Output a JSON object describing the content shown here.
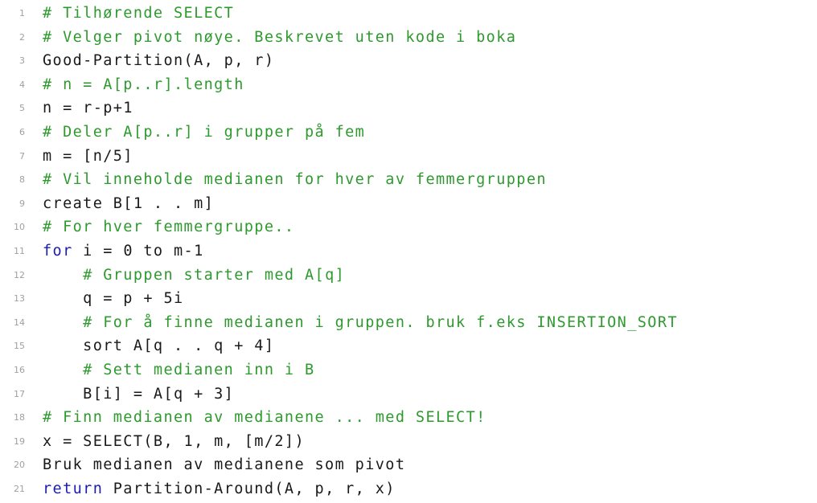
{
  "listing": {
    "lines": [
      {
        "num": "1",
        "text": "# Tilhørende SELECT",
        "kind": "comment"
      },
      {
        "num": "2",
        "text": "# Velger pivot nøye. Beskrevet uten kode i boka",
        "kind": "comment"
      },
      {
        "num": "3",
        "text": "Good-Partition(A, p, r)",
        "kind": "code"
      },
      {
        "num": "4",
        "text": "# n = A[p..r].length",
        "kind": "comment"
      },
      {
        "num": "5",
        "text": "n = r-p+1",
        "kind": "code"
      },
      {
        "num": "6",
        "text": "# Deler A[p..r] i grupper på fem",
        "kind": "comment"
      },
      {
        "num": "7",
        "text": "m = [n/5]",
        "kind": "code"
      },
      {
        "num": "8",
        "text": "# Vil inneholde medianen for hver av femmergruppen",
        "kind": "comment"
      },
      {
        "num": "9",
        "text": "create B[1 . . m]",
        "kind": "code"
      },
      {
        "num": "10",
        "text": "# For hver femmergruppe..",
        "kind": "comment"
      },
      {
        "num": "11",
        "keyword": "for",
        "rest": " i = 0 to m-1",
        "kind": "keyword"
      },
      {
        "num": "12",
        "indent": "    ",
        "text": "# Gruppen starter med A[q]",
        "kind": "comment"
      },
      {
        "num": "13",
        "indent": "    ",
        "text": "q = p + 5i",
        "kind": "code"
      },
      {
        "num": "14",
        "indent": "    ",
        "text": "# For å finne medianen i gruppen. bruk f.eks INSERTION_SORT",
        "kind": "comment"
      },
      {
        "num": "15",
        "indent": "    ",
        "text": "sort A[q . . q + 4]",
        "kind": "code"
      },
      {
        "num": "16",
        "indent": "    ",
        "text": "# Sett medianen inn i B",
        "kind": "comment"
      },
      {
        "num": "17",
        "indent": "    ",
        "text": "B[i] = A[q + 3]",
        "kind": "code"
      },
      {
        "num": "18",
        "text": "# Finn medianen av medianene ... med SELECT!",
        "kind": "comment"
      },
      {
        "num": "19",
        "text": "x = SELECT(B, 1, m, [m/2])",
        "kind": "code"
      },
      {
        "num": "20",
        "text": "Bruk medianen av medianene som pivot",
        "kind": "code"
      },
      {
        "num": "21",
        "keyword": "return",
        "rest": " Partition-Around(A, p, r, x)",
        "kind": "keyword"
      }
    ]
  },
  "colors": {
    "comment": "#2e9a2e",
    "keyword": "#1c1cb4",
    "code": "#1a1a1a",
    "line_number": "#a0a0a0"
  }
}
